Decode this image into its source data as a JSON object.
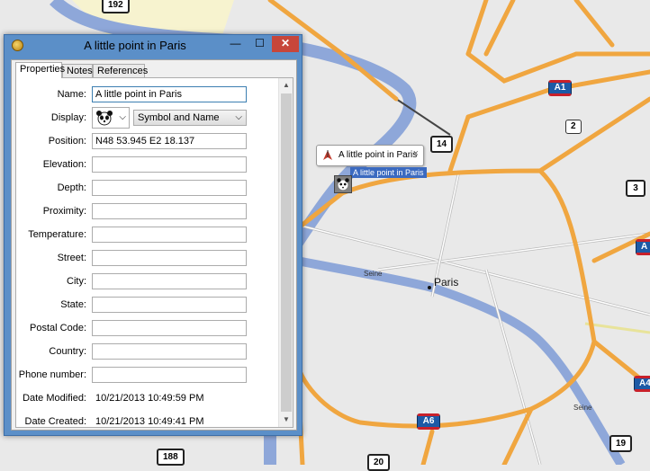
{
  "dialog": {
    "title": "A little point in Paris",
    "buttons": {
      "minimize": "—",
      "maximize": "☐",
      "close": "✕"
    },
    "tabs": [
      {
        "label": "Properties",
        "active": true
      },
      {
        "label": "Notes",
        "active": false
      },
      {
        "label": "References",
        "active": false
      }
    ],
    "fields": {
      "name": {
        "label": "Name:",
        "value": "A little point in Paris"
      },
      "display": {
        "label": "Display:",
        "symbol_icon": "panda-icon",
        "selected": "Symbol and Name"
      },
      "position": {
        "label": "Position:",
        "value": "N48 53.945 E2 18.137"
      },
      "elevation": {
        "label": "Elevation:",
        "value": ""
      },
      "depth": {
        "label": "Depth:",
        "value": ""
      },
      "proximity": {
        "label": "Proximity:",
        "value": ""
      },
      "temperature": {
        "label": "Temperature:",
        "value": ""
      },
      "street": {
        "label": "Street:",
        "value": ""
      },
      "city": {
        "label": "City:",
        "value": ""
      },
      "state": {
        "label": "State:",
        "value": ""
      },
      "postal_code": {
        "label": "Postal Code:",
        "value": ""
      },
      "country": {
        "label": "Country:",
        "value": ""
      },
      "phone": {
        "label": "Phone number:",
        "value": ""
      },
      "date_modified": {
        "label": "Date Modified:",
        "value": "10/21/2013 10:49:59 PM"
      },
      "date_created": {
        "label": "Date Created:",
        "value": "10/21/2013 10:49:41 PM"
      }
    }
  },
  "map": {
    "popup_text": "A little point in Paris",
    "popup_close": "×",
    "selected_label": "A little point in Paris",
    "city_label": "Paris",
    "river_labels": [
      "Seine",
      "Seine"
    ],
    "shields": [
      "192",
      "14",
      "A1",
      "2",
      "3",
      "A",
      "A6",
      "20",
      "188",
      "19",
      "A4"
    ],
    "colors": {
      "motorway": "#f0a640",
      "river": "#8ea7d9",
      "background": "#e9e9e9"
    }
  }
}
